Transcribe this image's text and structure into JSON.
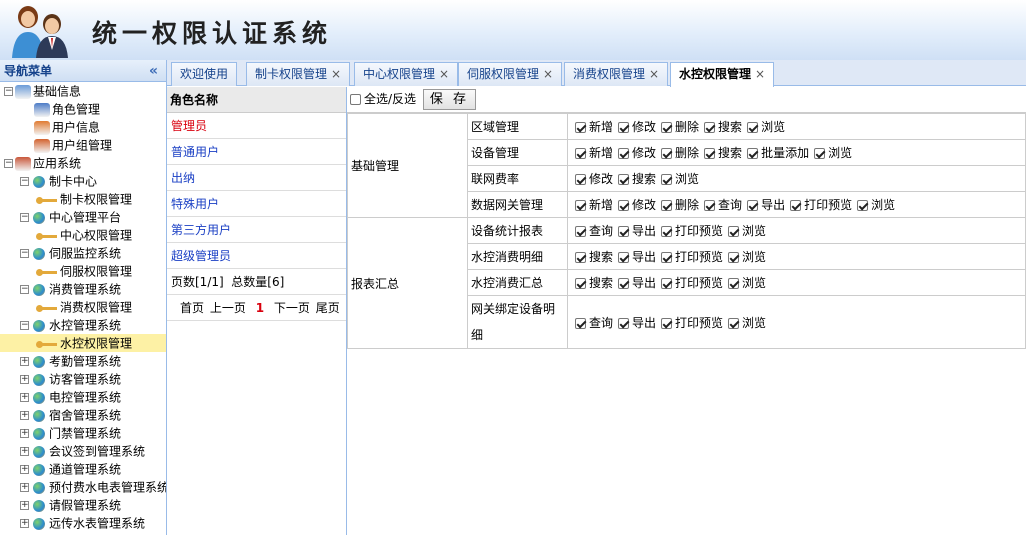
{
  "app": {
    "title": "统一权限认证系统"
  },
  "sidebar": {
    "title": "导航菜单",
    "collapse_glyph": "«",
    "tree": [
      {
        "label": "基础信息",
        "level": 0,
        "icon": "book-icon",
        "exp": "−"
      },
      {
        "label": "角色管理",
        "level": 1,
        "icon": "users-icon"
      },
      {
        "label": "用户信息",
        "level": 1,
        "icon": "user-icon"
      },
      {
        "label": "用户组管理",
        "level": 1,
        "icon": "group-icon"
      },
      {
        "label": "应用系统",
        "level": 0,
        "icon": "house-icon",
        "exp": "−"
      },
      {
        "label": "制卡中心",
        "level": 1,
        "icon": "globe-icon",
        "exp": "−"
      },
      {
        "label": "制卡权限管理",
        "level": 2,
        "icon": "key-icon"
      },
      {
        "label": "中心管理平台",
        "level": 1,
        "icon": "globe-icon",
        "exp": "−"
      },
      {
        "label": "中心权限管理",
        "level": 2,
        "icon": "key-icon"
      },
      {
        "label": "伺服监控系统",
        "level": 1,
        "icon": "globe-icon",
        "exp": "−"
      },
      {
        "label": "伺服权限管理",
        "level": 2,
        "icon": "key-icon"
      },
      {
        "label": "消费管理系统",
        "level": 1,
        "icon": "globe-icon",
        "exp": "−"
      },
      {
        "label": "消费权限管理",
        "level": 2,
        "icon": "key-icon"
      },
      {
        "label": "水控管理系统",
        "level": 1,
        "icon": "globe-icon",
        "exp": "−"
      },
      {
        "label": "水控权限管理",
        "level": 2,
        "icon": "key-icon",
        "selected": true
      },
      {
        "label": "考勤管理系统",
        "level": 1,
        "icon": "globe-icon",
        "exp": "+"
      },
      {
        "label": "访客管理系统",
        "level": 1,
        "icon": "globe-icon",
        "exp": "+"
      },
      {
        "label": "电控管理系统",
        "level": 1,
        "icon": "globe-icon",
        "exp": "+"
      },
      {
        "label": "宿舍管理系统",
        "level": 1,
        "icon": "globe-icon",
        "exp": "+"
      },
      {
        "label": "门禁管理系统",
        "level": 1,
        "icon": "globe-icon",
        "exp": "+"
      },
      {
        "label": "会议签到管理系统",
        "level": 1,
        "icon": "globe-icon",
        "exp": "+"
      },
      {
        "label": "通道管理系统",
        "level": 1,
        "icon": "globe-icon",
        "exp": "+"
      },
      {
        "label": "预付费水电表管理系统",
        "level": 1,
        "icon": "globe-icon",
        "exp": "+"
      },
      {
        "label": "请假管理系统",
        "level": 1,
        "icon": "globe-icon",
        "exp": "+"
      },
      {
        "label": "远传水表管理系统",
        "level": 1,
        "icon": "globe-icon",
        "exp": "+"
      }
    ]
  },
  "tabs": [
    {
      "label": "欢迎使用",
      "closable": false
    },
    {
      "label": "制卡权限管理",
      "closable": true
    },
    {
      "label": "中心权限管理",
      "closable": true
    },
    {
      "label": "伺服权限管理",
      "closable": true
    },
    {
      "label": "消费权限管理",
      "closable": true
    },
    {
      "label": "水控权限管理",
      "closable": true,
      "active": true
    }
  ],
  "tab_close_glyph": "×",
  "roles": {
    "header": "角色名称",
    "items": [
      {
        "label": "管理员",
        "color": "#d9000e"
      },
      {
        "label": "普通用户",
        "color": "#1a3fc4"
      },
      {
        "label": "出纳",
        "color": "#1a3fc4"
      },
      {
        "label": "特殊用户",
        "color": "#1a3fc4"
      },
      {
        "label": "第三方用户",
        "color": "#1a3fc4"
      },
      {
        "label": "超级管理员",
        "color": "#1a3fc4"
      }
    ],
    "pager_info": "页数[1/1]  总数量[6]",
    "first": "首页",
    "prev": "上一页",
    "current": "1",
    "next": "下一页",
    "last": "尾页"
  },
  "permissions": {
    "select_all_label": "全选/反选",
    "save_label": "保 存",
    "groups": [
      {
        "name": "基础管理",
        "rows": [
          {
            "name": "区域管理",
            "options": [
              "新增",
              "修改",
              "删除",
              "搜索",
              "浏览"
            ]
          },
          {
            "name": "设备管理",
            "options": [
              "新增",
              "修改",
              "删除",
              "搜索",
              "批量添加",
              "浏览"
            ]
          },
          {
            "name": "联网费率",
            "options": [
              "修改",
              "搜索",
              "浏览"
            ]
          },
          {
            "name": "数据网关管理",
            "options": [
              "新增",
              "修改",
              "删除",
              "查询",
              "导出",
              "打印预览",
              "浏览"
            ]
          }
        ]
      },
      {
        "name": "报表汇总",
        "rows": [
          {
            "name": "设备统计报表",
            "options": [
              "查询",
              "导出",
              "打印预览",
              "浏览"
            ]
          },
          {
            "name": "水控消费明细",
            "options": [
              "搜索",
              "导出",
              "打印预览",
              "浏览"
            ]
          },
          {
            "name": "水控消费汇总",
            "options": [
              "搜索",
              "导出",
              "打印预览",
              "浏览"
            ]
          },
          {
            "name": "网关绑定设备明细",
            "options": [
              "查询",
              "导出",
              "打印预览",
              "浏览"
            ],
            "tall": true
          }
        ]
      }
    ]
  }
}
